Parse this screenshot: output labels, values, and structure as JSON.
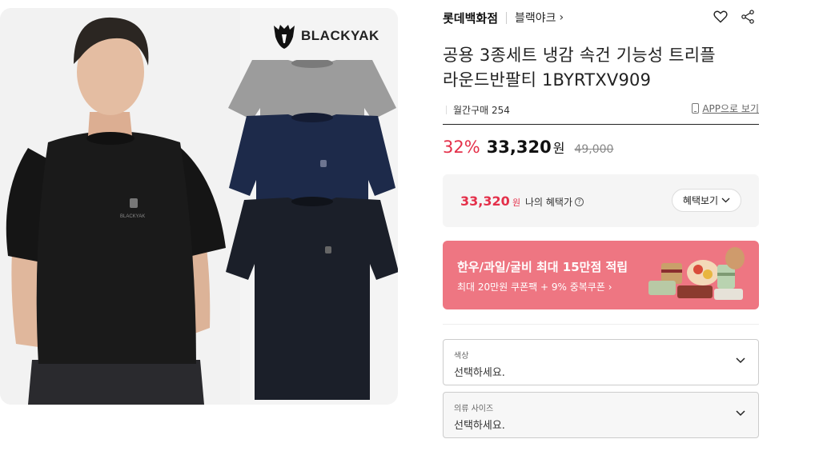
{
  "image": {
    "brand_logo_text": "BLACKYAK",
    "shirt_logo_text": "BLACKYAK"
  },
  "header": {
    "store": "롯데백화점",
    "brand": "블랙야크",
    "brand_chevron": "›"
  },
  "icons": {
    "wishlist": "heart-icon",
    "share": "share-icon"
  },
  "product": {
    "title_line1": "공용 3종세트 냉감 속건 기능성 트리플",
    "title_line2": "라운드반팔티 1BYRTXV909",
    "monthly_sales": "월간구매 254",
    "app_link": "APP으로 보기"
  },
  "price": {
    "discount": "32%",
    "sale": "33,320",
    "won": "원",
    "original": "49,000"
  },
  "benefit": {
    "price": "33,320",
    "won": "원",
    "label": "나의 혜택가",
    "info": "?",
    "button": "혜택보기"
  },
  "banner": {
    "headline": "한우/과일/굴비 최대 15만점 적립",
    "sub": "최대 20만원 쿠폰팩 + 9% 중복쿠폰 ›"
  },
  "options": {
    "color": {
      "label": "색상",
      "value": "선택하세요."
    },
    "size": {
      "label": "의류 사이즈",
      "value": "선택하세요."
    }
  },
  "colors": {
    "accent_red": "#e4304a",
    "banner_pink": "#ee7682"
  }
}
